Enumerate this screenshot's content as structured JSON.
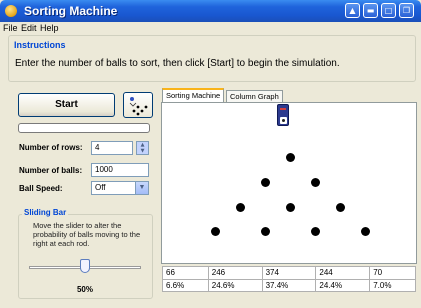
{
  "window": {
    "title": "Sorting Machine"
  },
  "menu": [
    "File",
    "Edit",
    "Help"
  ],
  "instructions": {
    "title": "Instructions",
    "text": "Enter the number of balls to sort, then click [Start] to begin the simulation."
  },
  "controls": {
    "start_label": "Start",
    "progress": 0,
    "rows_label": "Number of rows:",
    "rows_value": "4",
    "balls_label": "Number of balls:",
    "balls_value": "1000",
    "speed_label": "Ball Speed:",
    "speed_value": "Off"
  },
  "sliding_bar": {
    "title": "Sliding Bar",
    "description": "Move the slider to alter the probability of balls moving to the right at each rod.",
    "value": 0.5,
    "value_label": "50%"
  },
  "tabs": [
    {
      "label": "Sorting Machine",
      "active": true
    },
    {
      "label": "Column Graph",
      "active": false
    }
  ],
  "results": {
    "counts": [
      "66",
      "246",
      "374",
      "244",
      "70"
    ],
    "percents": [
      "6.6%",
      "24.6%",
      "37.4%",
      "24.4%",
      "7.0%"
    ]
  },
  "colors": {
    "accent_blue": "#0046d5",
    "title_bar": "#1f64dc"
  },
  "icons": [
    "app-icon",
    "minimize-icon",
    "maximize-icon",
    "restore-icon",
    "close-icon",
    "balls-icon",
    "hopper-icon"
  ]
}
